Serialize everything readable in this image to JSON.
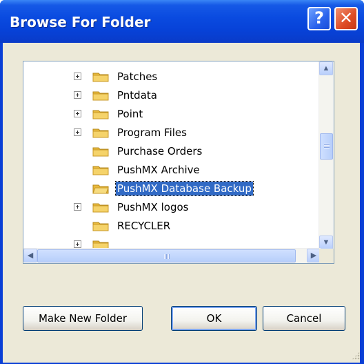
{
  "window": {
    "title": "Browse For Folder",
    "help_label": "?",
    "close_label": "✕"
  },
  "tree": {
    "items": [
      {
        "label": "Patches",
        "expandable": true
      },
      {
        "label": "Pntdata",
        "expandable": true
      },
      {
        "label": "Point",
        "expandable": true
      },
      {
        "label": "Program Files",
        "expandable": true
      },
      {
        "label": "Purchase Orders",
        "expandable": false
      },
      {
        "label": "PushMX Archive",
        "expandable": false
      },
      {
        "label": "PushMX Database Backup",
        "expandable": false,
        "selected": true
      },
      {
        "label": "PushMX logos",
        "expandable": true
      },
      {
        "label": "RECYCLER",
        "expandable": false
      }
    ]
  },
  "buttons": {
    "make_new_folder": "Make New Folder",
    "ok": "OK",
    "cancel": "Cancel"
  },
  "colors": {
    "title_bar": "#0a4be0",
    "selection": "#316ac5",
    "dialog_bg": "#ece9d8",
    "folder": "#f5d36a"
  }
}
